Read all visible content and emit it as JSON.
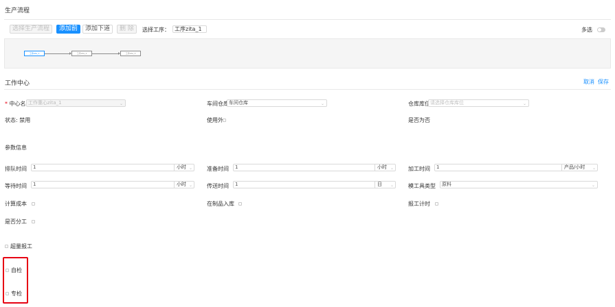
{
  "process": {
    "title": "生产流程",
    "toolbar": {
      "select_flow": "选择生产流程",
      "add_prev": "添加前",
      "add_next": "添加下道",
      "delete": "删 除",
      "select_step_label": "选择工序：",
      "select_step_value": "工序zita_1"
    },
    "multi_select_label": "多选",
    "nodes": [
      "工序zita_1",
      "工序zita_2",
      "工序zita_3"
    ]
  },
  "work_center": {
    "title": "工作中心",
    "cancel": "取消",
    "save": "保存",
    "center_name_label": "中心名",
    "center_name_value": "工作重心zita_1",
    "workshop_label": "车间仓库",
    "workshop_value": "车间仓库",
    "warehouse_label": "仓库库位",
    "warehouse_placeholder": "请选择仓库库位",
    "status_label": "状态:",
    "status_value": "禁用",
    "outsource_label": "使用外",
    "is_default_label": "是否为",
    "is_default_value": "否"
  },
  "params": {
    "title": "参数信息",
    "queue_time": {
      "label": "排队时间",
      "value": "1",
      "unit": "小时"
    },
    "prep_time": {
      "label": "准备时间",
      "value": "1",
      "unit": "小时"
    },
    "process_time": {
      "label": "加工时间",
      "value": "1",
      "unit": "产品/小时"
    },
    "wait_time": {
      "label": "等待时间",
      "value": "1",
      "unit": "小时"
    },
    "transfer_time": {
      "label": "传送时间",
      "value": "1",
      "unit": "日"
    },
    "tool_type": {
      "label": "模工具类型",
      "value": "原料"
    },
    "calc_cost_label": "计算成本",
    "wip_storage_label": "在制品入库",
    "report_timing_label": "报工计时",
    "split_work_label": "是否分工",
    "over_report_label": "超量报工",
    "self_check_label": "自检",
    "special_check_label": "专检"
  }
}
